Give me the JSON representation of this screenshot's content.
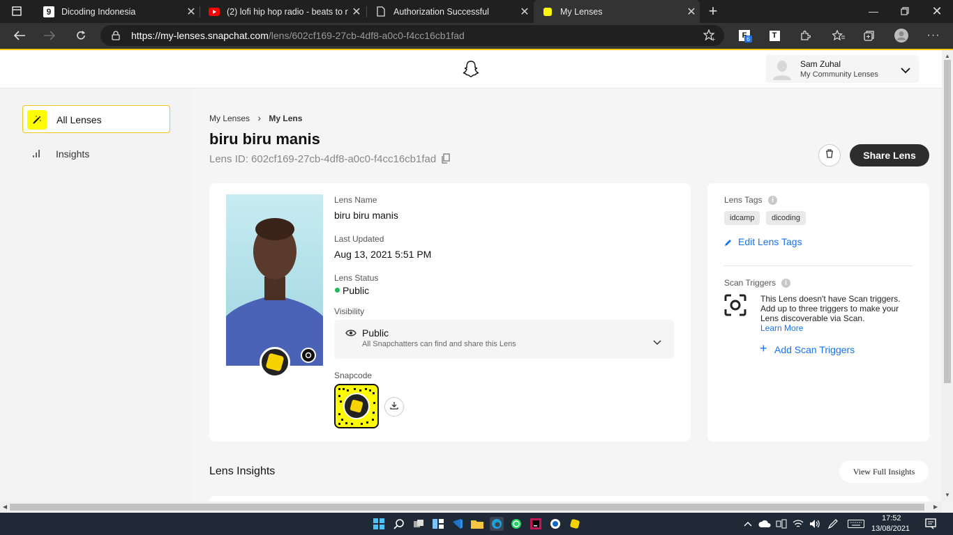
{
  "browser": {
    "tabs": [
      {
        "label": "Dicoding Indonesia",
        "icon": "dicoding-icon"
      },
      {
        "label": "(2) lofi hip hop radio - beats to r",
        "icon": "youtube-icon"
      },
      {
        "label": "Authorization Successful",
        "icon": "page-icon"
      },
      {
        "label": "My Lenses",
        "icon": "snapchat-icon"
      }
    ],
    "url_host": "https://my-lenses.snapchat.com",
    "url_path": "/lens/602cf169-27cb-4df8-a0c0-f4cc16cb1fad",
    "extension_badge": "6"
  },
  "header": {
    "user_name": "Sam Zuhal",
    "user_sub": "My Community Lenses"
  },
  "sidebar": {
    "items": [
      {
        "label": "All Lenses"
      },
      {
        "label": "Insights"
      }
    ]
  },
  "page": {
    "breadcrumb_root": "My Lenses",
    "breadcrumb_current": "My Lens",
    "title": "biru biru manis",
    "lens_id": "Lens ID: 602cf169-27cb-4df8-a0c0-f4cc16cb1fad",
    "share_label": "Share Lens"
  },
  "details": {
    "name_label": "Lens Name",
    "name_value": "biru biru manis",
    "updated_label": "Last Updated",
    "updated_value": "Aug 13, 2021 5:51 PM",
    "status_label": "Lens Status",
    "status_value": "Public",
    "visibility_label": "Visibility",
    "visibility_value": "Public",
    "visibility_sub": "All Snapchatters can find and share this Lens",
    "snapcode_label": "Snapcode"
  },
  "tags": {
    "label": "Lens Tags",
    "items": [
      "idcamp",
      "dicoding"
    ],
    "edit_label": "Edit Lens Tags"
  },
  "scan": {
    "label": "Scan Triggers",
    "text_1": "This Lens doesn't have Scan triggers.",
    "text_2": "Add up to three triggers to make your",
    "text_3": "Lens discoverable via Scan.",
    "learn_more": "Learn More",
    "add_label": "Add Scan Triggers"
  },
  "insights": {
    "title": "Lens Insights",
    "view_full": "View Full Insights"
  },
  "taskbar": {
    "time": "17:52",
    "date": "13/08/2021"
  },
  "colors": {
    "accent": "#FFFC00",
    "status_green": "#1db954",
    "share_btn": "#2d2d2d",
    "link": "#1a73e8"
  }
}
